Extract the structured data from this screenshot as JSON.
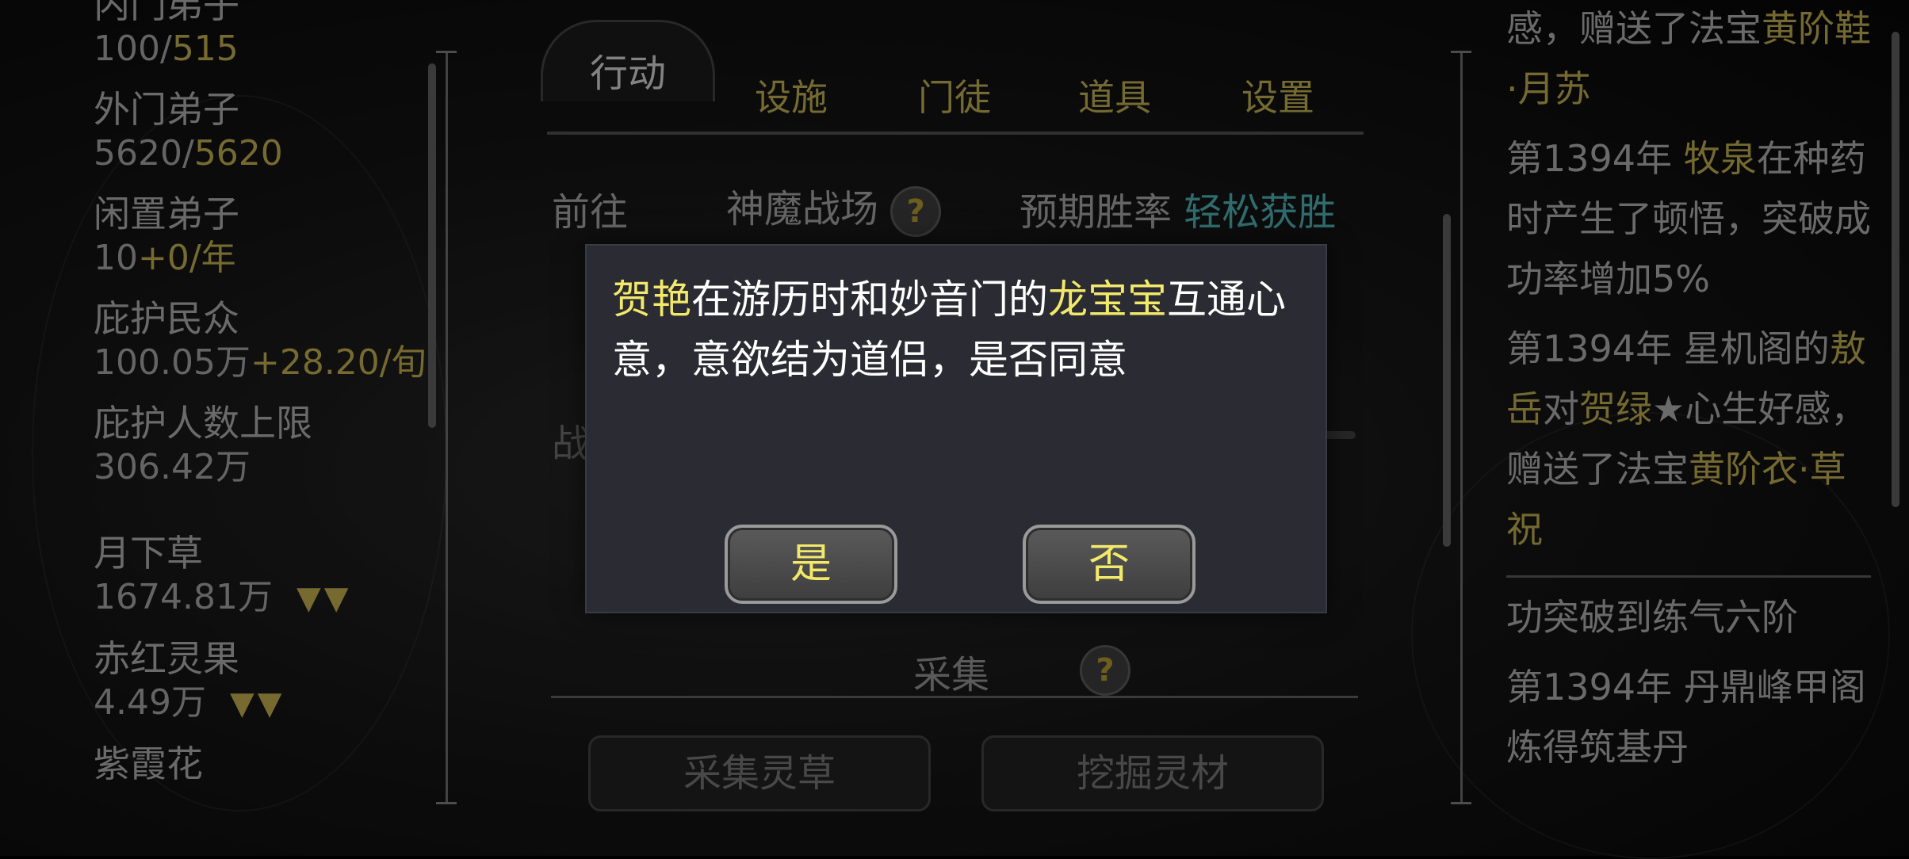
{
  "left_panel": {
    "stats": [
      {
        "label": "内门弟子",
        "value_main": "100/",
        "value_extra": "515"
      },
      {
        "label": "外门弟子",
        "value_main": "5620/",
        "value_extra": "5620"
      },
      {
        "label": "闲置弟子",
        "value_main": "10",
        "value_extra": "+0/年"
      },
      {
        "label": "庇护民众",
        "value_main": "100.05万",
        "value_extra": "+28.20/旬"
      },
      {
        "label": "庇护人数上限",
        "value_main": "",
        "value_extra": "306.42万"
      }
    ],
    "resources": [
      {
        "label": "月下草",
        "value": "1674.81万",
        "trend": "▼▼"
      },
      {
        "label": "赤红灵果",
        "value": "4.49万",
        "trend": "▼▼"
      },
      {
        "label": "紫霞花",
        "value": "",
        "trend": ""
      }
    ]
  },
  "tabs": {
    "items": [
      "行动",
      "设施",
      "门徒",
      "道具",
      "设置"
    ],
    "active": "行动"
  },
  "action": {
    "go_label": "前往",
    "destination": "神魔战场",
    "help_symbol": "?",
    "win_rate_label": "预期胜率",
    "win_rate_value": "轻松获胜",
    "status_label": "战斗中"
  },
  "gather": {
    "section_title": "采集",
    "help_symbol": "?",
    "buttons": [
      "采集灵草",
      "挖掘灵材"
    ]
  },
  "log": {
    "entries": [
      [
        {
          "t": "感，赠送了法宝",
          "c": "n"
        },
        {
          "t": "黄阶鞋·月苏",
          "c": "y"
        }
      ],
      [
        {
          "t": "第1394年 ",
          "c": "n"
        },
        {
          "t": "牧泉",
          "c": "y"
        },
        {
          "t": "在种药时产生了顿悟，突破成功率增加5%",
          "c": "n"
        }
      ],
      [
        {
          "t": "第1394年 星机阁的",
          "c": "n"
        },
        {
          "t": "敖岳",
          "c": "y"
        },
        {
          "t": "对",
          "c": "n"
        },
        {
          "t": "贺绿",
          "c": "y"
        },
        {
          "t": "★心生好感，赠送了法宝",
          "c": "n"
        },
        {
          "t": "黄阶衣·草祝",
          "c": "y"
        }
      ],
      [
        {
          "t": "功突破到练气六阶",
          "c": "n"
        }
      ],
      [
        {
          "t": "第1394年 丹鼎峰甲阁炼得筑基丹",
          "c": "n"
        }
      ]
    ]
  },
  "dialog": {
    "name1": "贺艳",
    "text1": "在游历时和妙音门的",
    "name2": "龙宝宝",
    "text2": "互通心意，意欲结为道侣，是否同意",
    "yes_label": "是",
    "no_label": "否"
  },
  "colors": {
    "highlight": "#f2e86a",
    "gold": "#b6a34a",
    "teal": "#4aa7a9",
    "dialog_bg": "#2b2b33"
  }
}
